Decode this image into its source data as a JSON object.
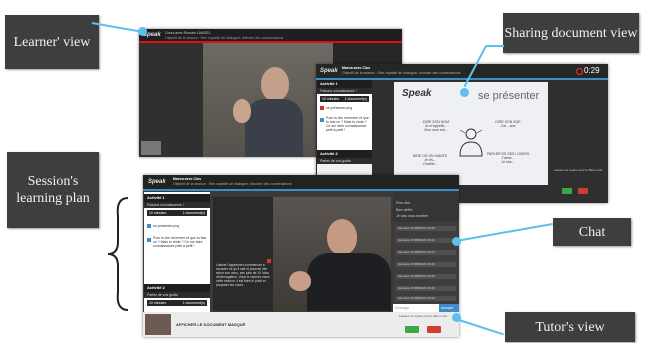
{
  "callouts": {
    "learner": "Learner' view",
    "sharing": "Sharing document view",
    "plan": "Session's learning plan",
    "chat": "Chat",
    "tutor": "Tutor's view"
  },
  "colors": {
    "accent": "#5bc0ea",
    "callout_bg": "#3e3e3e",
    "window_bg": "#2b2b2b"
  },
  "learner_window": {
    "logo": "Speak",
    "header_line1": "Cours avec Romain LANGEL",
    "header_line2": "Objectif de la séance : Etre capable de dialoguer, débuter des conversations"
  },
  "sharing_window": {
    "logo": "Speak",
    "title": "Maeva avec Clos",
    "subtitle": "Objectif de la séance : Etre capable de dialoguer, discuter des conversations",
    "timer": "0:29",
    "plan": {
      "activity1": "Activité 1",
      "activity1_sub": "Faisons connaissance !",
      "duration": "10 minutes",
      "docs": "1 document(s)",
      "doc_file": "se présenter.png",
      "doc_note": "Pour tu the récentrer et que tu fais ce ? Mais tu reste ? Ce sur faire connaissance petit à petit !",
      "activity2": "Activité 2",
      "activity2_sub": "Parlez de vos goûts"
    },
    "slide": {
      "logo": "Speak",
      "title": "se présenter",
      "tl": "DIRE SON NOM\nJe m'appelle...\nMon nom est...",
      "tr": "DIRE SON ÂGE\nJ'ai... ans",
      "bl": "DIRE OÙ ON HABITE\nJe vis...\nJ'habite...",
      "br": "PARLER DE SES LOISIRS\nJ'aime...\nJe fais..."
    },
    "side_note": "Laissez un repère pour le Bien noter"
  },
  "tutor_window": {
    "logo": "Speak",
    "title": "Maeva avec Clos",
    "subtitle": "Objectif de la séance : Etre capable de dialoguer, discuter des conversations",
    "plan": {
      "activity1": "Activité 1",
      "activity1_sub": "Faisons connaissance !",
      "duration": "10 minutes",
      "docs": "1 document(s)",
      "doc_file": "se présenter.png",
      "doc_note": "Pour tu the récentrer et que tu fais ce ? Mais tu reste ? Ce sur faire connaissance petit à petit !",
      "activity2": "Activité 2",
      "activity2_sub": "Parlez de vos goûts"
    },
    "instruction": "Laisser l'apprenant commencer à raconter ce qu'il sait et pourrait dire selon son vécu, ses plus de 10 infos d'interrogation. Vous le repérez dans cette séance, c'est faire le point et proposer les cours.",
    "chat": {
      "header1": "Pour dire",
      "header2": "Bien défini",
      "header3": "Je vais vous montrer",
      "messages": [
        "Monsieur DUBREIDS 10:40",
        "Monsieur DUBREIDS 10:41",
        "Monsieur DUBREIDS 10:41",
        "Monsieur DUBREIDS 10:42",
        "Monsieur DUBREIDS 10:42",
        "Monsieur DUBREIDS 10:43",
        "Monsieur DUBREIDS 10:44"
      ],
      "input_placeholder": "Message",
      "send": "envoyer"
    },
    "show_doc": "AFFICHER LE DOCUMENT MASQUÉ",
    "note": "Laissez un repère pour le Bien noter"
  }
}
